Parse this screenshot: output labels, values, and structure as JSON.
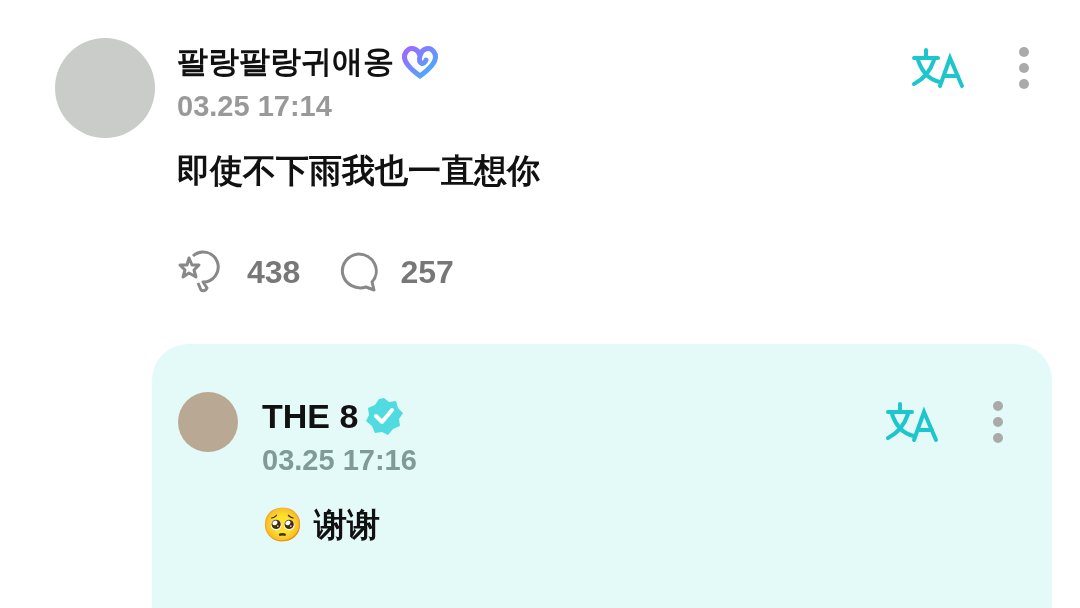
{
  "post": {
    "author": "팔랑팔랑귀애옹",
    "kind": "membership",
    "time": "03.25 17:14",
    "text": "即使不下雨我也一直想你",
    "likes": "438",
    "comments": "257"
  },
  "reply": {
    "author": "THE 8",
    "kind": "verified",
    "time": "03.25 17:16",
    "text": "🥺 谢谢"
  }
}
